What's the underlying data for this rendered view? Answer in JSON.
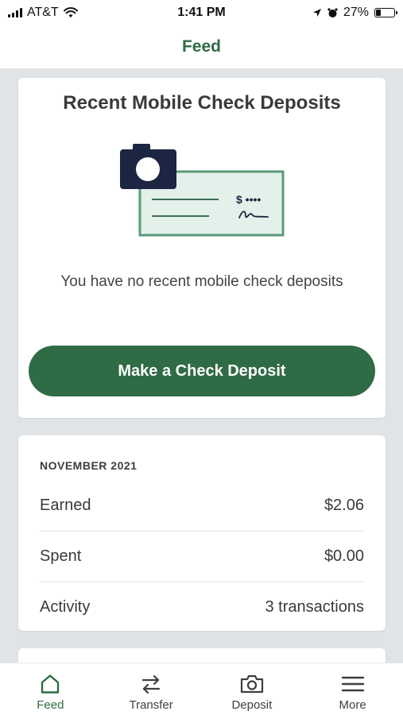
{
  "status_bar": {
    "carrier": "AT&T",
    "time": "1:41 PM",
    "battery": "27%",
    "battery_level": 0.27,
    "icons": [
      "signal-icon",
      "wifi-icon",
      "location-icon",
      "alarm-icon",
      "battery-icon"
    ]
  },
  "header": {
    "title": "Feed"
  },
  "deposits_card": {
    "title": "Recent Mobile Check Deposits",
    "empty_message": "You have no recent mobile check deposits",
    "button_label": "Make a Check Deposit",
    "check_amount": "$ ••••"
  },
  "summary_card": {
    "month": "NOVEMBER 2021",
    "rows": [
      {
        "label": "Earned",
        "value": "$2.06"
      },
      {
        "label": "Spent",
        "value": "$0.00"
      },
      {
        "label": "Activity",
        "value": "3 transactions"
      }
    ]
  },
  "tab_bar": {
    "tabs": [
      {
        "label": "Feed",
        "icon": "home-icon",
        "active": true
      },
      {
        "label": "Transfer",
        "icon": "transfer-arrows-icon",
        "active": false
      },
      {
        "label": "Deposit",
        "icon": "camera-icon",
        "active": false
      },
      {
        "label": "More",
        "icon": "menu-icon",
        "active": false
      }
    ]
  },
  "colors": {
    "brand_green": "#2f6b44",
    "illustration_green": "#5a9a78",
    "illustration_fill": "#e3f1ea",
    "camera_navy": "#1c2541",
    "background": "#e1e4e6"
  }
}
